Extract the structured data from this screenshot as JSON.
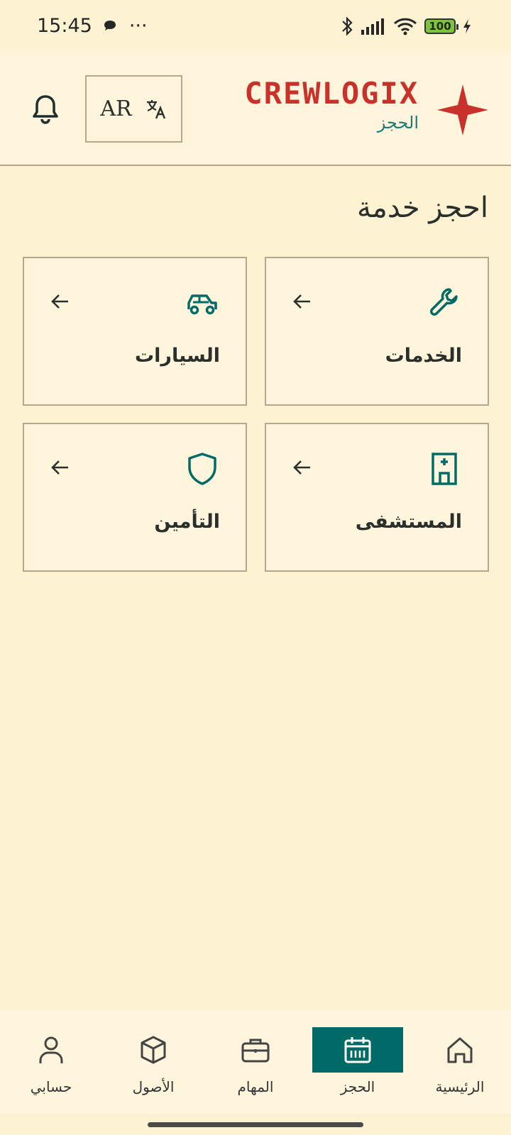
{
  "status_bar": {
    "time": "15:45",
    "more": "···",
    "battery": "100"
  },
  "header": {
    "brand_title": "CREWLOGIX",
    "brand_subtitle": "الحجز",
    "language_code": "AR",
    "brand_color": "#c8322a",
    "accent_color": "#1f7a74"
  },
  "main": {
    "title": "احجز خدمة",
    "cards": [
      {
        "label": "الخدمات",
        "icon": "wrench-icon"
      },
      {
        "label": "السيارات",
        "icon": "car-icon"
      },
      {
        "label": "المستشفى",
        "icon": "hospital-icon"
      },
      {
        "label": "التأمين",
        "icon": "shield-icon"
      }
    ]
  },
  "bottom_nav": {
    "items": [
      {
        "label": "الرئيسية",
        "icon": "home-icon"
      },
      {
        "label": "الحجز",
        "icon": "calendar-icon",
        "active": true
      },
      {
        "label": "المهام",
        "icon": "briefcase-icon"
      },
      {
        "label": "الأصول",
        "icon": "cube-icon"
      },
      {
        "label": "حسابي",
        "icon": "user-icon"
      }
    ],
    "active_color": "#006b66"
  }
}
